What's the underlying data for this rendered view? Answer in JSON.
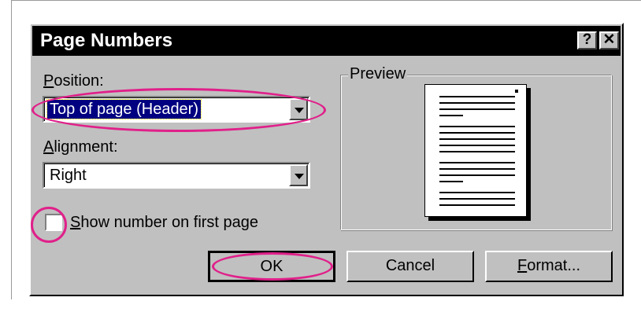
{
  "dialog": {
    "title": "Page Numbers",
    "help_button": "?",
    "close_button": "✕"
  },
  "position": {
    "label_first": "P",
    "label_rest": "osition:",
    "value": "Top of page (Header)"
  },
  "alignment": {
    "label_first": "A",
    "label_rest": "lignment:",
    "value": "Right"
  },
  "first_page": {
    "checked": false,
    "label_first": "S",
    "label_rest": "how number on first page"
  },
  "preview": {
    "legend": "Preview"
  },
  "buttons": {
    "ok": "OK",
    "cancel": "Cancel",
    "format_first": "F",
    "format_rest": "ormat..."
  },
  "annotation_color": "#e0208a"
}
